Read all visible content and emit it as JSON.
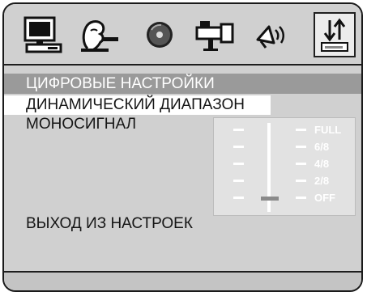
{
  "toolbar": {
    "icons": [
      {
        "name": "system-monitor-icon",
        "selected": false
      },
      {
        "name": "language-speaker-icon",
        "selected": false
      },
      {
        "name": "disc-icon",
        "selected": false
      },
      {
        "name": "video-camera-icon",
        "selected": false
      },
      {
        "name": "audio-speaker-icon",
        "selected": false
      },
      {
        "name": "preferences-sort-icon",
        "selected": true
      }
    ]
  },
  "menu": {
    "header": "ЦИФРОВЫЕ НАСТРОЙКИ",
    "items": [
      {
        "label": "ДИНАМИЧЕСКИЙ ДИАПАЗОН",
        "selected": true
      },
      {
        "label": "МОНОСИГНАЛ",
        "selected": false
      }
    ],
    "exit_label": "ВЫХОД ИЗ НАСТРОЕК"
  },
  "range_panel": {
    "levels": [
      "FULL",
      "6/8",
      "4/8",
      "2/8",
      "OFF"
    ],
    "current_level": "OFF"
  },
  "colors": {
    "background": "#d0d0d0",
    "header_bar": "#9a9a9a",
    "selection": "#ffffff"
  }
}
